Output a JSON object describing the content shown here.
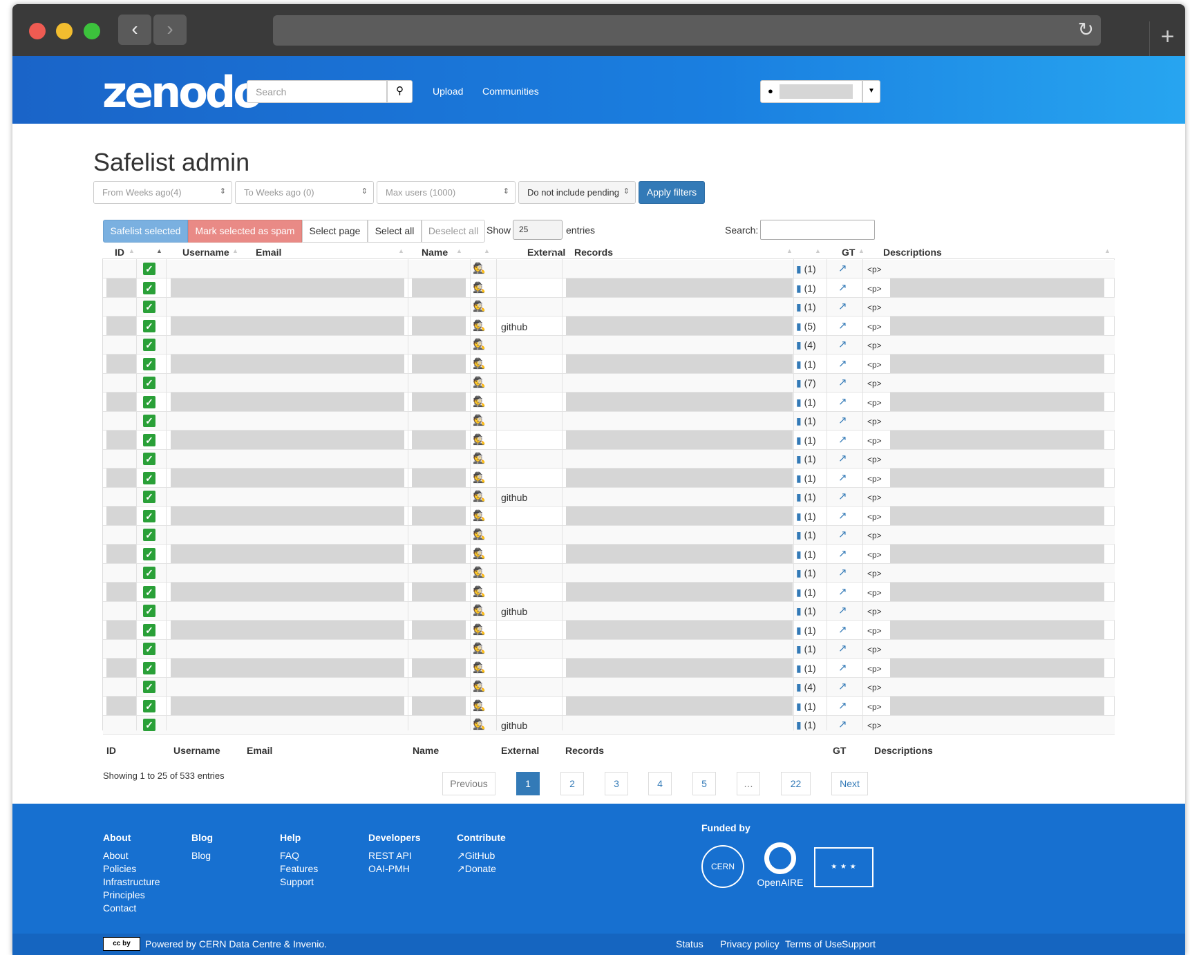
{
  "header": {
    "logo": "zenodo",
    "search_placeholder": "Search",
    "upload": "Upload",
    "communities": "Communities"
  },
  "page": {
    "title": "Safelist admin"
  },
  "filters": {
    "from_weeks": "From Weeks ago(4)",
    "to_weeks": "To Weeks ago (0)",
    "max_users": "Max users (1000)",
    "pending": "Do not include pending",
    "apply": "Apply filters"
  },
  "toolbar": {
    "safelist_selected": "Safelist selected",
    "mark_spam": "Mark selected as spam",
    "select_page": "Select page",
    "select_all": "Select all",
    "deselect_all": "Deselect all",
    "show": "Show",
    "show_value": "25",
    "entries": "entries",
    "search": "Search:"
  },
  "table": {
    "headers": [
      "ID",
      "Username",
      "Email",
      "Name",
      "External",
      "Records",
      "GT",
      "Descriptions"
    ],
    "rows": [
      {
        "external": "",
        "records": "(1)",
        "desc": "<p>"
      },
      {
        "external": "",
        "records": "(1)",
        "desc": "<p>"
      },
      {
        "external": "",
        "records": "(1)",
        "desc": "<p>"
      },
      {
        "external": "github",
        "records": "(5)",
        "desc": "<p>"
      },
      {
        "external": "",
        "records": "(4)",
        "desc": "<p>"
      },
      {
        "external": "",
        "records": "(1)",
        "desc": "<p>"
      },
      {
        "external": "",
        "records": "(7)",
        "desc": "<p>"
      },
      {
        "external": "",
        "records": "(1)",
        "desc": "<p>"
      },
      {
        "external": "",
        "records": "(1)",
        "desc": "<p>"
      },
      {
        "external": "",
        "records": "(1)",
        "desc": "<p>"
      },
      {
        "external": "",
        "records": "(1)",
        "desc": "<p>"
      },
      {
        "external": "",
        "records": "(1)",
        "desc": "<p>"
      },
      {
        "external": "github",
        "records": "(1)",
        "desc": "<p>"
      },
      {
        "external": "",
        "records": "(1)",
        "desc": "<p>"
      },
      {
        "external": "",
        "records": "(1)",
        "desc": "<p>"
      },
      {
        "external": "",
        "records": "(1)",
        "desc": "<p>"
      },
      {
        "external": "",
        "records": "(1)",
        "desc": "<p>"
      },
      {
        "external": "",
        "records": "(1)",
        "desc": "<p>"
      },
      {
        "external": "github",
        "records": "(1)",
        "desc": "<p>"
      },
      {
        "external": "",
        "records": "(1)",
        "desc": "<p>"
      },
      {
        "external": "",
        "records": "(1)",
        "desc": "<p>"
      },
      {
        "external": "",
        "records": "(1)",
        "desc": "<p>"
      },
      {
        "external": "",
        "records": "(4)",
        "desc": "<p>"
      },
      {
        "external": "",
        "records": "(1)",
        "desc": "<p>"
      },
      {
        "external": "github",
        "records": "(1)",
        "desc": "<p>"
      }
    ]
  },
  "pagination": {
    "info": "Showing 1 to 25 of 533 entries",
    "previous": "Previous",
    "pages": [
      "1",
      "2",
      "3",
      "4",
      "5",
      "…",
      "22"
    ],
    "next": "Next"
  },
  "footer": {
    "columns": [
      {
        "title": "About",
        "links": [
          "About",
          "Policies",
          "Infrastructure",
          "Principles",
          "Contact"
        ]
      },
      {
        "title": "Blog",
        "links": [
          "Blog"
        ]
      },
      {
        "title": "Help",
        "links": [
          "FAQ",
          "Features",
          "Support"
        ]
      },
      {
        "title": "Developers",
        "links": [
          "REST API",
          "OAI-PMH"
        ]
      },
      {
        "title": "Contribute",
        "links": [
          "GitHub",
          "Donate"
        ]
      }
    ],
    "funded_by": "Funded by",
    "openaire": "OpenAIRE",
    "cern": "CERN",
    "powered": "Powered by CERN Data Centre & Invenio.",
    "bottom_links": [
      "Status",
      "Privacy policy",
      "Terms of Use",
      "Support"
    ]
  },
  "colors": {
    "brand_blue": "#1770d0",
    "primary_button": "#337ab7",
    "spam_button": "#e98a86",
    "safelist_button": "#7ab0e0",
    "checkbox_green": "#2aa038"
  }
}
